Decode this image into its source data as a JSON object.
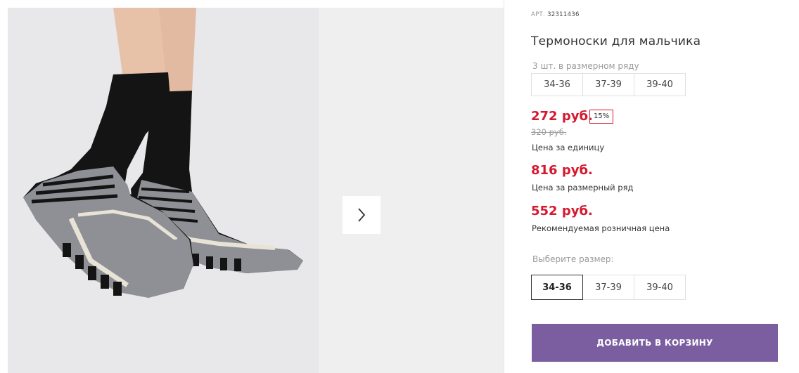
{
  "product": {
    "article_label": "АРТ.",
    "article_number": "32311436",
    "title": "Термоноски для мальчика",
    "pack_label": "3 шт. в размерном ряду",
    "pack_sizes": [
      "34-36",
      "37-39",
      "39-40"
    ],
    "unit_price": "272 руб.",
    "discount": "15%",
    "old_price": "320 руб.",
    "unit_price_caption": "Цена за единицу",
    "row_price": "816 руб.",
    "row_price_caption": "Цена за размерный ряд",
    "retail_price": "552 руб.",
    "retail_price_caption": "Рекомендуемая розничная цена",
    "choose_size_label": "Выберите размер:",
    "size_options": [
      "34-36",
      "37-39",
      "39-40"
    ],
    "selected_size": "34-36",
    "add_to_cart": "ДОБАВИТЬ В КОРЗИНУ"
  },
  "gallery": {
    "next_icon": "chevron-right-icon"
  },
  "colors": {
    "price_red": "#d6182f",
    "button_purple": "#7b5ea0",
    "sock_black": "#141414",
    "sock_gray": "#8e9095"
  }
}
